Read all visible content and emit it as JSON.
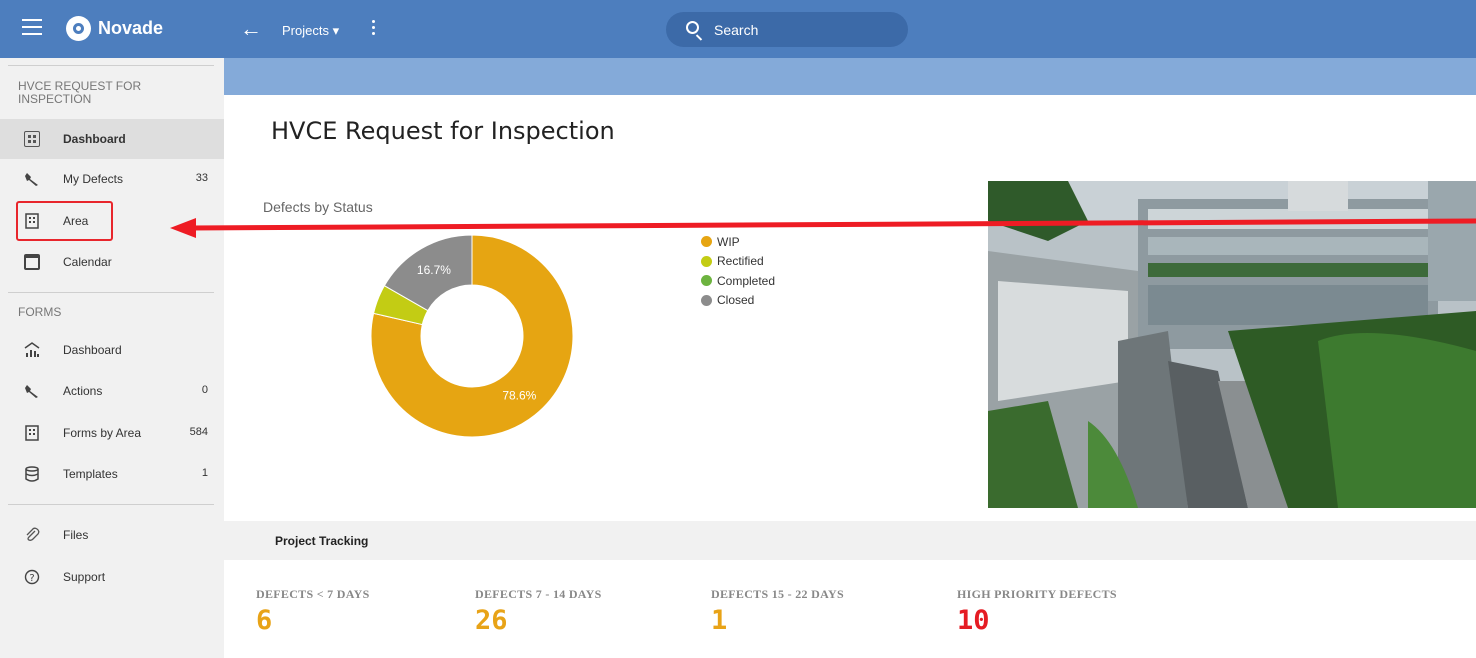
{
  "app": {
    "name": "Novade"
  },
  "topbar": {
    "projects_label": "Projects ▾",
    "search_placeholder": "Search"
  },
  "sidebar": {
    "section1_title": "HVCE REQUEST FOR INSPECTION",
    "section1_items": [
      {
        "label": "Dashboard",
        "count": "",
        "icon": "dashboard-grid-icon"
      },
      {
        "label": "My Defects",
        "count": "33",
        "icon": "wrench-icon"
      },
      {
        "label": "Area",
        "count": "",
        "icon": "building-icon"
      },
      {
        "label": "Calendar",
        "count": "",
        "icon": "calendar-icon"
      }
    ],
    "section2_title": "FORMS",
    "section2_items": [
      {
        "label": "Dashboard",
        "count": "",
        "icon": "chart-dashboard-icon"
      },
      {
        "label": "Actions",
        "count": "0",
        "icon": "wrench-icon"
      },
      {
        "label": "Forms by Area",
        "count": "584",
        "icon": "building-icon"
      },
      {
        "label": "Templates",
        "count": "1",
        "icon": "database-icon"
      }
    ],
    "section3_items": [
      {
        "label": "Files",
        "icon": "paperclip-icon"
      },
      {
        "label": "Support",
        "icon": "help-icon"
      }
    ]
  },
  "main": {
    "title": "HVCE Request for Inspection",
    "tracking_title": "Project Tracking",
    "metrics": [
      {
        "label": "DEFECTS < 7 DAYS",
        "value": "6",
        "color": "#e8a317"
      },
      {
        "label": "DEFECTS 7 - 14 DAYS",
        "value": "26",
        "color": "#e8a317"
      },
      {
        "label": "DEFECTS 15 - 22 DAYS",
        "value": "1",
        "color": "#e8a317"
      },
      {
        "label": "HIGH PRIORITY DEFECTS",
        "value": "10",
        "color": "#e51c23"
      }
    ]
  },
  "chart_data": {
    "type": "pie",
    "title": "Defects by Status",
    "labels": [
      "WIP",
      "Rectified",
      "Completed",
      "Closed"
    ],
    "values": [
      78.6,
      4.7,
      0,
      16.7
    ],
    "data_labels": [
      "78.6%",
      "",
      "",
      "16.7%"
    ],
    "colors": [
      "#e6a512",
      "#c3cc14",
      "#6db33f",
      "#8c8c8c"
    ],
    "legend_position": "right"
  },
  "colors": {
    "topbar": "#4d7ebe",
    "subbar": "#84aad9",
    "annotation_red": "#e8262c"
  }
}
